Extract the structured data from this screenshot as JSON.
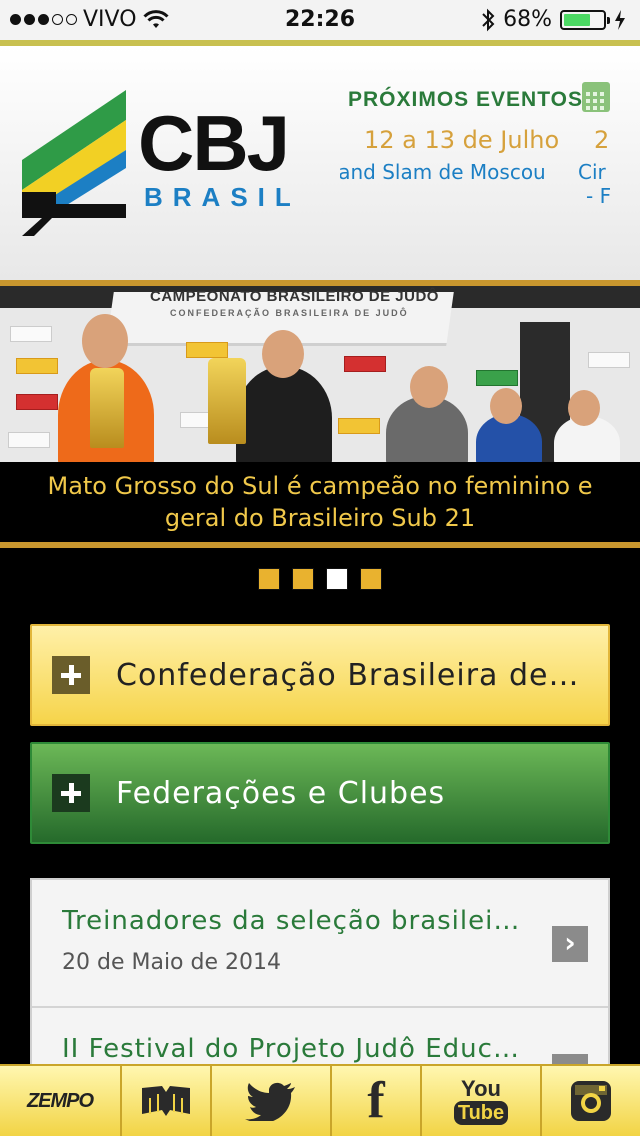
{
  "status_bar": {
    "carrier": "VIVO",
    "time": "22:26",
    "battery_percent": "68%",
    "battery_level": 0.68,
    "signal_bars": 3,
    "icons": [
      "wifi-icon",
      "bluetooth-icon",
      "battery-icon",
      "charging-icon"
    ]
  },
  "header": {
    "logo_text": "CBJ",
    "logo_subtext": "BRASIL",
    "events_title": "PRÓXIMOS EVENTOS",
    "events_date": "12 a 13 de Julho",
    "events_date_next": "2",
    "events_name": "rand Slam de Moscou",
    "events_name_next": "Cir",
    "events_name_cont": "- F"
  },
  "slider": {
    "banner_title": "CAMPEONATO BRASILEIRO DE JUDÔ",
    "banner_subtitle": "CONFEDERAÇÃO BRASILEIRA DE JUDÔ",
    "caption": "Mato Grosso do Sul é campeão no feminino e geral do Brasileiro Sub 21",
    "page_count": 4,
    "active_index": 2
  },
  "accordion": [
    {
      "label": "Confederação Brasileira de Judô",
      "color": "#f6d44a"
    },
    {
      "label": "Federações e Clubes",
      "color": "#2e8a37"
    }
  ],
  "news": [
    {
      "title": "Treinadores da seleção brasileira de judô",
      "date": "20 de Maio de 2014"
    },
    {
      "title": "II Festival do Projeto Judô  Educação",
      "date": ""
    }
  ],
  "tabbar": {
    "zempo_label": "ZEMPO",
    "facebook_label": "f",
    "youtube_you": "You",
    "youtube_tube": "Tube",
    "icons": [
      "zempo-icon",
      "book-icon",
      "twitter-icon",
      "facebook-icon",
      "youtube-icon",
      "instagram-icon"
    ]
  },
  "colors": {
    "accent_gold": "#e9b22f",
    "brand_green": "#2a7a3a",
    "brand_blue": "#1c7fc4",
    "caption_text": "#f0c84a"
  }
}
